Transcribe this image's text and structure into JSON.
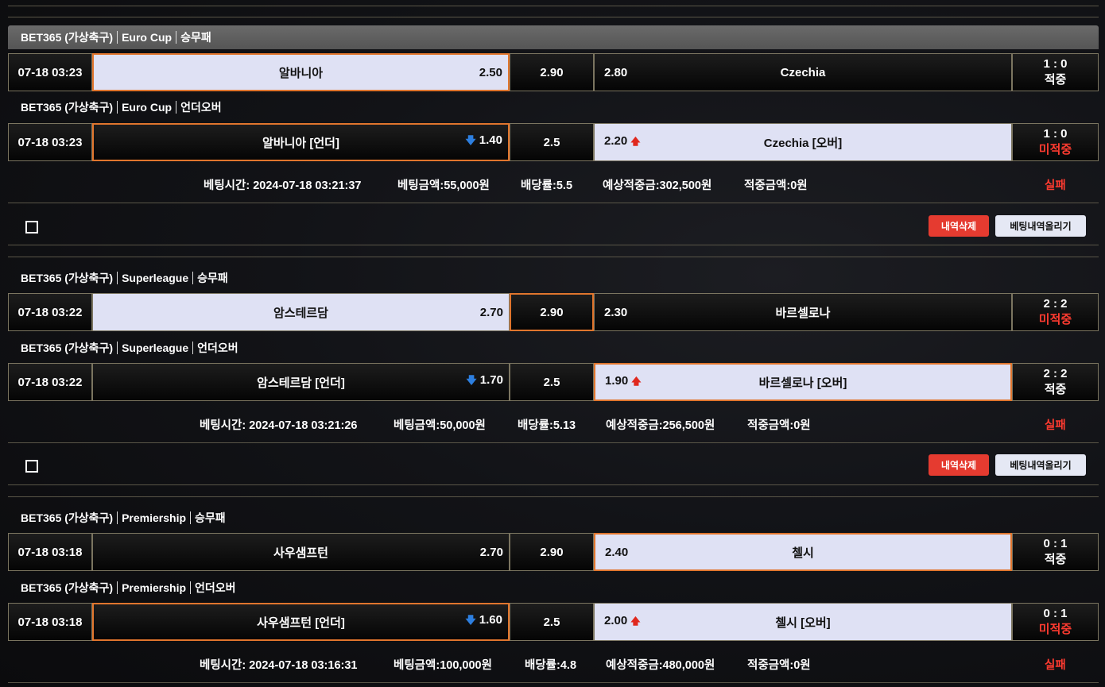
{
  "bets": [
    {
      "groups": [
        {
          "provider": "BET365 (가상축구)",
          "league": "Euro Cup",
          "market": "승무패",
          "time": "07-18 03:23",
          "home": "알바니아",
          "home_odd": "2.50",
          "draw": "2.90",
          "away_odd": "2.80",
          "away": "Czechia",
          "score": "1 : 0",
          "status": "적중"
        },
        {
          "provider": "BET365 (가상축구)",
          "league": "Euro Cup",
          "market": "언더오버",
          "time": "07-18 03:23",
          "home": "알바니아 [언더]",
          "home_odd": "1.40",
          "draw": "2.5",
          "away_odd": "2.20",
          "away": "Czechia [오버]",
          "score": "1 : 0",
          "status": "미적중"
        }
      ],
      "summary": {
        "bet_time": "베팅시간: 2024-07-18 03:21:37",
        "amount": "베팅금액:55,000원",
        "rate": "배당률:5.5",
        "expected": "예상적중금:302,500원",
        "won": "적중금액:0원",
        "result": "실패"
      }
    },
    {
      "groups": [
        {
          "provider": "BET365 (가상축구)",
          "league": "Superleague",
          "market": "승무패",
          "time": "07-18 03:22",
          "home": "암스테르담",
          "home_odd": "2.70",
          "draw": "2.90",
          "away_odd": "2.30",
          "away": "바르셀로나",
          "score": "2 : 2",
          "status": "미적중"
        },
        {
          "provider": "BET365 (가상축구)",
          "league": "Superleague",
          "market": "언더오버",
          "time": "07-18 03:22",
          "home": "암스테르담 [언더]",
          "home_odd": "1.70",
          "draw": "2.5",
          "away_odd": "1.90",
          "away": "바르셀로나 [오버]",
          "score": "2 : 2",
          "status": "적중"
        }
      ],
      "summary": {
        "bet_time": "베팅시간: 2024-07-18 03:21:26",
        "amount": "베팅금액:50,000원",
        "rate": "배당률:5.13",
        "expected": "예상적중금:256,500원",
        "won": "적중금액:0원",
        "result": "실패"
      }
    },
    {
      "groups": [
        {
          "provider": "BET365 (가상축구)",
          "league": "Premiership",
          "market": "승무패",
          "time": "07-18 03:18",
          "home": "사우샘프턴",
          "home_odd": "2.70",
          "draw": "2.90",
          "away_odd": "2.40",
          "away": "첼시",
          "score": "0 : 1",
          "status": "적중"
        },
        {
          "provider": "BET365 (가상축구)",
          "league": "Premiership",
          "market": "언더오버",
          "time": "07-18 03:18",
          "home": "사우샘프턴 [언더]",
          "home_odd": "1.60",
          "draw": "2.5",
          "away_odd": "2.00",
          "away": "첼시 [오버]",
          "score": "0 : 1",
          "status": "미적중"
        }
      ],
      "summary": {
        "bet_time": "베팅시간: 2024-07-18 03:16:31",
        "amount": "베팅금액:100,000원",
        "rate": "배당률:4.8",
        "expected": "예상적중금:480,000원",
        "won": "적중금액:0원",
        "result": "실패"
      }
    }
  ],
  "actions": {
    "delete_label": "내역삭제",
    "post_label": "베팅내역올리기"
  },
  "icons": {
    "odds_down": "arrow-down-icon",
    "odds_up": "arrow-up-icon",
    "checkbox": "checkbox-icon"
  },
  "colors": {
    "selected_border": "#e0752d",
    "loss": "#ff3b30",
    "odds_down": "#2d7fe0",
    "odds_up": "#e0281e",
    "delete_button": "#e53b30"
  }
}
